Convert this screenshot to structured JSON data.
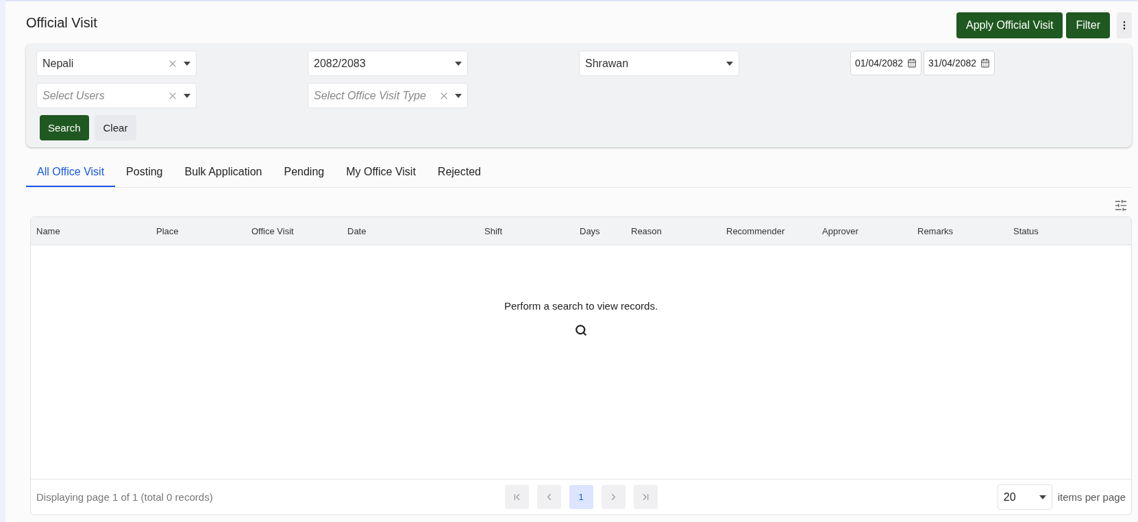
{
  "page": {
    "title": "Official Visit"
  },
  "header_buttons": [
    "Apply Official Visit",
    "Filter"
  ],
  "filters": {
    "row_1": [
      {
        "kind": "select",
        "value": "Nepali",
        "clearable": true
      },
      {
        "kind": "select",
        "value": "2082/2083",
        "clearable": false
      },
      {
        "kind": "select",
        "value": "Shrawan",
        "clearable": false
      },
      {
        "kind": "dates",
        "from": "01/04/2082",
        "to": "31/04/2082"
      }
    ],
    "row_2": [
      {
        "kind": "select",
        "placeholder": "Select Users",
        "clearable": true
      },
      {
        "kind": "select",
        "placeholder": "Select Office Visit Type",
        "clearable": true
      }
    ],
    "buttons": [
      "Search",
      "Clear"
    ]
  },
  "tabs": [
    {
      "label": "All Office Visit",
      "selected": true
    },
    {
      "label": "Posting",
      "selected": false
    },
    {
      "label": "Bulk Application",
      "selected": false
    },
    {
      "label": "Pending",
      "selected": false
    },
    {
      "label": "My Office Visit",
      "selected": false
    },
    {
      "label": "Rejected",
      "selected": false
    }
  ],
  "table": {
    "columns": [
      "Name",
      "Place",
      "Office Visit",
      "Date",
      "Shift",
      "Days",
      "Reason",
      "Recommender",
      "Approver",
      "Remarks",
      "Status"
    ],
    "empty_message": "Perform a search to view records."
  },
  "pagination": {
    "summary": "Displaying page 1 of 1 (total 0 records)",
    "pages": [
      {
        "label": "1",
        "selected": true
      }
    ],
    "page_size": "20",
    "page_size_label": "items per page"
  }
}
